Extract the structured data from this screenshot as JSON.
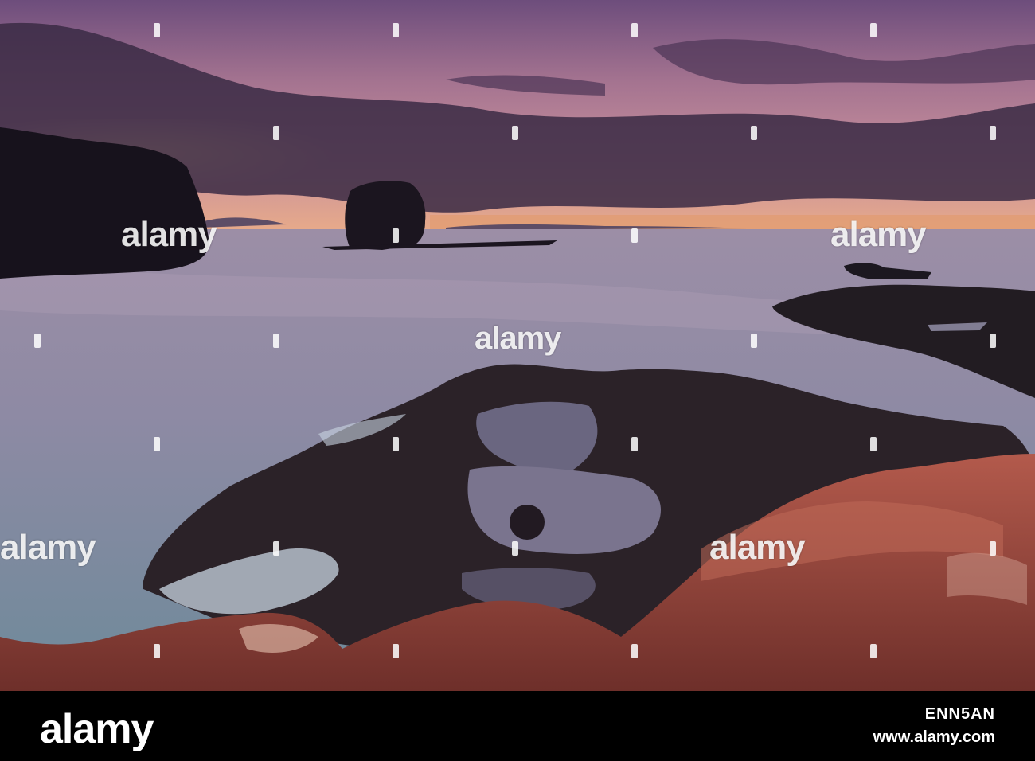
{
  "watermark": {
    "text": "alamy"
  },
  "footer": {
    "logo": "alamy",
    "image_code": "ENN5AN",
    "url": "www.alamy.com"
  },
  "colors": {
    "sky_top": "#7a5a86",
    "sky_glow": "#d69aa0",
    "sunset_orange": "#f2a55a",
    "water": "#8a8ea6",
    "rock_red": "#9b4a3e",
    "footer_bg": "#000000"
  }
}
